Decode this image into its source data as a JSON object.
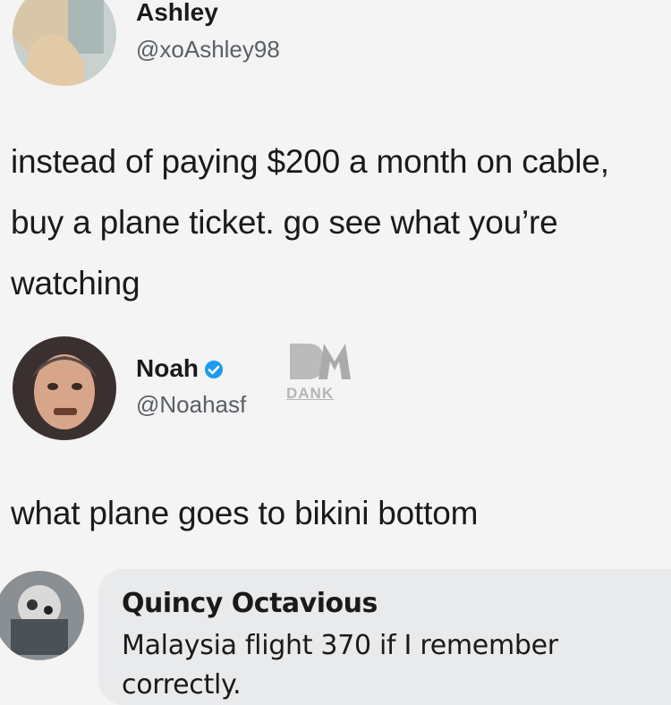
{
  "tweet1": {
    "name": "Ashley",
    "handle": "@xoAshley98",
    "text": "instead of paying $200 a month on cable, buy a plane ticket. go see what you’re watching"
  },
  "tweet2": {
    "name": "Noah",
    "handle": "@Noahasf",
    "verified": true,
    "text": "what plane goes to bikini bottom"
  },
  "watermark": {
    "logo": "DM",
    "text": "DANK"
  },
  "comment": {
    "name": "Quincy Octavious",
    "text": "Malaysia flight 370 if I remember correctly."
  },
  "colors": {
    "background": "#f4f4f4",
    "verified_blue": "#1d9bf0",
    "comment_bubble": "#e9eaec",
    "handle_gray": "#5a5f66"
  }
}
